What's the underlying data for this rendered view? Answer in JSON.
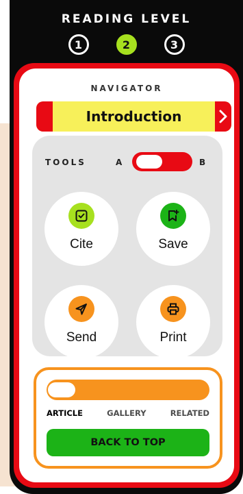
{
  "header": {
    "title": "READING LEVEL",
    "levels": [
      "1",
      "2",
      "3"
    ],
    "active_level": "2"
  },
  "navigator": {
    "title": "NAVIGATOR",
    "current_section": "Introduction",
    "next_icon": "chevron-right-icon"
  },
  "tools": {
    "title": "TOOLS",
    "option_a": "A",
    "option_b": "B",
    "selected_option": "A",
    "items": [
      {
        "label": "Cite",
        "icon": "checkbox-icon",
        "color": "#a7e01f"
      },
      {
        "label": "Save",
        "icon": "bookmark-plus-icon",
        "color": "#1cb317"
      },
      {
        "label": "Send",
        "icon": "send-icon",
        "color": "#f7931e"
      },
      {
        "label": "Print",
        "icon": "printer-icon",
        "color": "#f7931e"
      }
    ]
  },
  "content_tabs": {
    "tabs": [
      "ARTICLE",
      "GALLERY",
      "RELATED"
    ],
    "active_tab": "ARTICLE",
    "back_to_top": "BACK TO TOP"
  },
  "colors": {
    "frame": "#0a0a0a",
    "panel_red": "#e80a14",
    "nav_yellow": "#f7f05a",
    "lime": "#a7e01f",
    "green": "#1cb317",
    "orange": "#f7931e",
    "tools_gray": "#e4e4e4"
  }
}
